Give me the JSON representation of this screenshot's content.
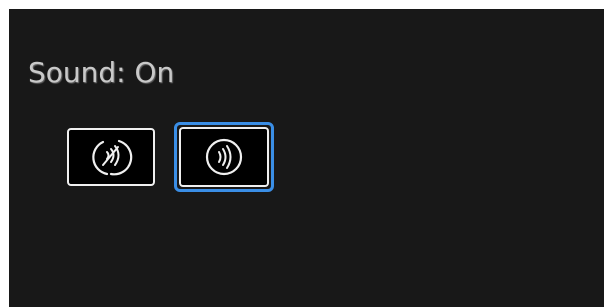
{
  "sound": {
    "status_text": "Sound: On",
    "state": "on"
  },
  "buttons": [
    {
      "name": "sound-off-button",
      "icon": "sound-off-icon",
      "selected": false
    },
    {
      "name": "sound-on-button",
      "icon": "sound-on-icon",
      "selected": true
    }
  ],
  "colors": {
    "background": "#181818",
    "text": "#c9c9c9",
    "button_border": "#f0f0f0",
    "selected_ring": "#3a8ee6"
  }
}
